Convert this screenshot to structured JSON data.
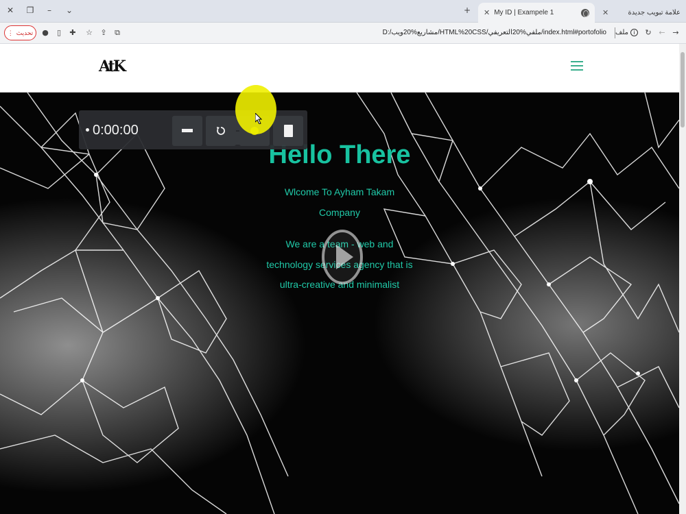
{
  "browser": {
    "tabs": [
      {
        "title": "My ID | Exampele 1",
        "active": true
      },
      {
        "title": "علامة تبويب جديدة",
        "active": false
      }
    ],
    "update_button_label": "تحديث",
    "url": "D:/مشاريع%20ويب/HTML%20CSS/ملفي%20التعريفي/index.html#portofolio",
    "url_label": "ملف"
  },
  "site": {
    "logo_text": "AtK",
    "hero": {
      "title": "Hello There",
      "line1": "Wlcome To Ayham Takam",
      "line2": "Company",
      "line3": "We are a team - web and",
      "line4": "technology services agency that is",
      "line5": "ultra-creative and minimalist"
    }
  },
  "recorder": {
    "timer": "0:00:00"
  },
  "colors": {
    "accent": "#18c2a0",
    "menu_icon": "#3aaf8d",
    "update_button": "#cc2222"
  },
  "icons": [
    "close-icon",
    "restore-icon",
    "minimize-icon",
    "chevron-down-icon",
    "plus-icon",
    "globe-icon",
    "back-icon",
    "forward-icon",
    "reload-icon",
    "info-icon",
    "star-icon",
    "extension-icon",
    "profile-icon",
    "sidebar-icon",
    "menu-icon",
    "play-icon",
    "microphone-icon",
    "speaker-icon",
    "pause-icon",
    "restart-icon",
    "record-icon",
    "stop-icon"
  ]
}
